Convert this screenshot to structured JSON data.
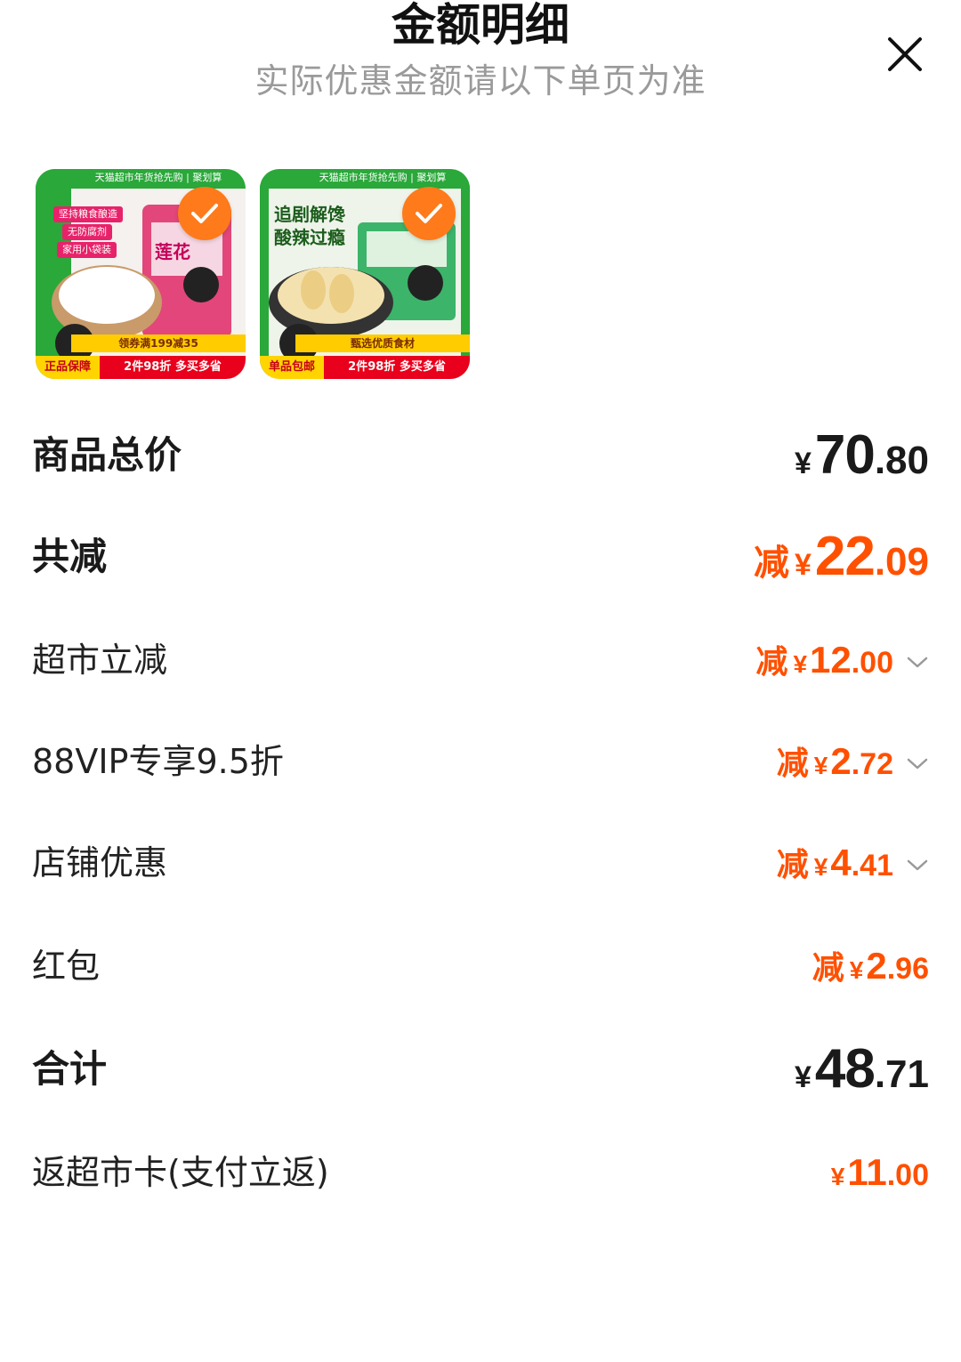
{
  "header": {
    "title": "金额明细",
    "subtitle": "实际优惠金额请以下单页为准",
    "close_icon": "close-icon"
  },
  "products": [
    {
      "top_banner": "天猫超市年货抢先购 | 聚划算",
      "tags": [
        "坚持粮食酿造",
        "无防腐剂",
        "家用小袋装"
      ],
      "name_fragment": "莲花",
      "activity_band": "领券满199减35",
      "badge": "正品保障",
      "promo": "2件98折 多买多省",
      "selected": true
    },
    {
      "top_banner": "天猫超市年货抢先购 | 聚划算",
      "headline": [
        "追剧解馋",
        "酸辣过瘾"
      ],
      "activity_band": "甄选优质食材",
      "badge": "单品包邮",
      "promo": "2件98折 多买多省",
      "selected": true
    }
  ],
  "summary": {
    "goods_total": {
      "label": "商品总价",
      "yen": "¥",
      "int": "70",
      "dec": ".80"
    },
    "total_discount": {
      "label": "共减",
      "prefix": "减",
      "yen": "¥",
      "int": "22",
      "dec": ".09"
    },
    "discounts": [
      {
        "label": "超市立减",
        "prefix": "减",
        "yen": "¥",
        "int": "12",
        "dec": ".00",
        "expandable": true
      },
      {
        "label": "88VIP专享9.5折",
        "prefix": "减",
        "yen": "¥",
        "int": "2",
        "dec": ".72",
        "expandable": true
      },
      {
        "label": "店铺优惠",
        "prefix": "减",
        "yen": "¥",
        "int": "4",
        "dec": ".41",
        "expandable": true
      },
      {
        "label": "红包",
        "prefix": "减",
        "yen": "¥",
        "int": "2",
        "dec": ".96",
        "expandable": false
      }
    ],
    "grand_total": {
      "label": "合计",
      "yen": "¥",
      "int": "48",
      "dec": ".71"
    },
    "cashback": {
      "label": "返超市卡(支付立返)",
      "yen": "¥",
      "int": "11",
      "dec": ".00"
    }
  },
  "colors": {
    "accent": "#ff5000",
    "check": "#ff7a1a",
    "subtitle": "#9a9a9a"
  }
}
